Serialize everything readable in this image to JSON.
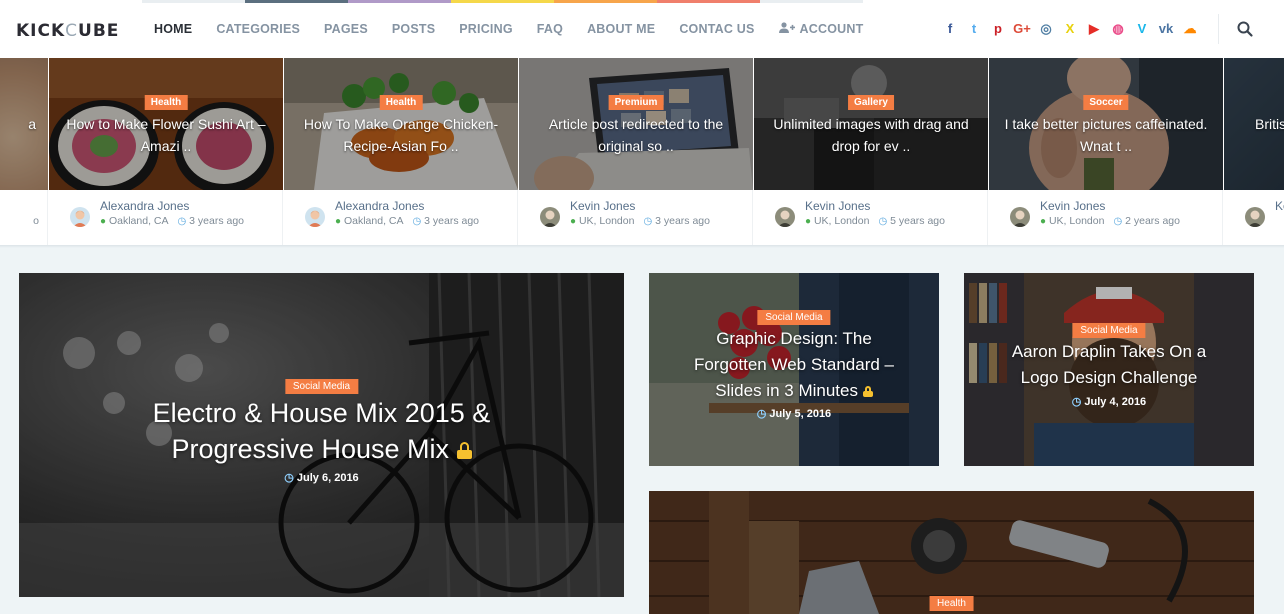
{
  "logo": {
    "part1": "KICK",
    "part2": "C",
    "part3": "UBE"
  },
  "nav": {
    "items": [
      {
        "label": "HOME"
      },
      {
        "label": "CATEGORIES"
      },
      {
        "label": "PAGES"
      },
      {
        "label": "POSTS"
      },
      {
        "label": "PRICING"
      },
      {
        "label": "FAQ"
      },
      {
        "label": "ABOUT ME"
      },
      {
        "label": "CONTAC US"
      },
      {
        "label": "ACCOUNT"
      }
    ],
    "stripe_colors": [
      "#e9eef1",
      "#5b6f7f",
      "#b09ac8",
      "#f5d84a",
      "#f7a54b",
      "#f07f6c",
      "#e9eef1"
    ]
  },
  "social": [
    {
      "icon": "facebook-icon",
      "glyph": "f",
      "color": "#3b5998"
    },
    {
      "icon": "twitter-icon",
      "glyph": "t",
      "color": "#55acee"
    },
    {
      "icon": "pinterest-icon",
      "glyph": "p",
      "color": "#cb2027"
    },
    {
      "icon": "google-plus-icon",
      "glyph": "G+",
      "color": "#dd4b39"
    },
    {
      "icon": "instagram-icon",
      "glyph": "◎",
      "color": "#517fa4"
    },
    {
      "icon": "xing-icon",
      "glyph": "X",
      "color": "#e8d20d"
    },
    {
      "icon": "youtube-icon",
      "glyph": "▶",
      "color": "#e52d27"
    },
    {
      "icon": "dribbble-icon",
      "glyph": "◍",
      "color": "#ea4c89"
    },
    {
      "icon": "vimeo-icon",
      "glyph": "V",
      "color": "#1ab7ea"
    },
    {
      "icon": "vk-icon",
      "glyph": "vk",
      "color": "#4c75a3"
    },
    {
      "icon": "soundcloud-icon",
      "glyph": "☁",
      "color": "#ff8800"
    }
  ],
  "slides": [
    {
      "category": "",
      "title": "a",
      "author": "",
      "location": "",
      "time": "o"
    },
    {
      "category": "Health",
      "title": "How to Make Flower Sushi Art – Amazi ..",
      "author": "Alexandra Jones",
      "location": "Oakland, CA",
      "time": "3 years ago"
    },
    {
      "category": "Health",
      "title": "How To Make Orange Chicken-Recipe-Asian Fo ..",
      "author": "Alexandra Jones",
      "location": "Oakland, CA",
      "time": "3 years ago"
    },
    {
      "category": "Premium",
      "title": "Article post redirected to the original so ..",
      "author": "Kevin Jones",
      "location": "UK, London",
      "time": "3 years ago"
    },
    {
      "category": "Gallery",
      "title": "Unlimited images with drag and drop for ev ..",
      "author": "Kevin Jones",
      "location": "UK, London",
      "time": "5 years ago"
    },
    {
      "category": "Soccer",
      "title": "I take better pictures caffeinated. Wnat t ..",
      "author": "Kevin Jones",
      "location": "UK, London",
      "time": "2 years ago"
    },
    {
      "category": "",
      "title": "Britis",
      "author": "Ke",
      "location": "",
      "time": ""
    }
  ],
  "cards": [
    {
      "category": "Social Media",
      "title": "Electro & House Mix 2015 & Progressive House Mix",
      "date": "July 6, 2016",
      "locked": true
    },
    {
      "category": "Social Media",
      "title": "Graphic Design: The Forgotten Web Standard – Slides in 3 Minutes",
      "date": "July 5, 2016",
      "locked": true
    },
    {
      "category": "Social Media",
      "title": "Aaron Draplin Takes On a Logo Design Challenge",
      "date": "July 4, 2016",
      "locked": false
    },
    {
      "category": "Health",
      "title": "",
      "date": "",
      "locked": false
    }
  ],
  "colors": {
    "accent": "#f47d43",
    "lock": "#f6c12f"
  }
}
